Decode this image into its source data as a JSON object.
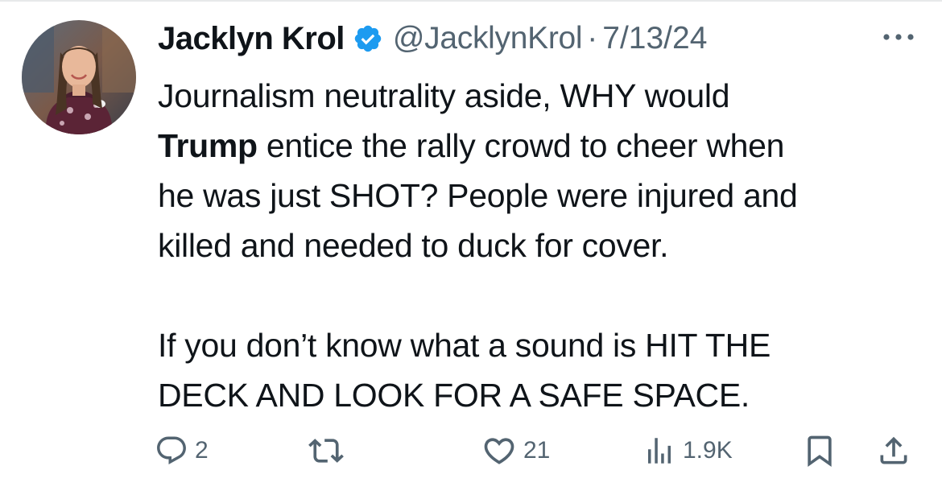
{
  "author": {
    "name": "Jacklyn Krol",
    "handle": "@JacklynKrol",
    "separator": "·",
    "date": "7/13/24",
    "verified": true,
    "verified_color": "#1d9bf0"
  },
  "tweet": {
    "line1": "Journalism neutrality aside, WHY would",
    "line2_bold": "Trump",
    "line2_rest": " entice the rally crowd to cheer when",
    "line3": "he was just SHOT? People were injured and",
    "line4": "killed and needed to duck for cover.",
    "line5": "If you don’t know what a sound is HIT THE",
    "line6": "DECK AND LOOK FOR A SAFE SPACE."
  },
  "actions": {
    "reply": {
      "icon": "reply-icon",
      "count": "2"
    },
    "repost": {
      "icon": "repost-icon",
      "count": ""
    },
    "like": {
      "icon": "heart-icon",
      "count": "21"
    },
    "views": {
      "icon": "views-icon",
      "count": "1.9K"
    },
    "bookmark": {
      "icon": "bookmark-icon"
    },
    "share": {
      "icon": "share-icon"
    }
  },
  "colors": {
    "text": "#0f1419",
    "secondary": "#536471",
    "divider": "#e7e9ea"
  }
}
